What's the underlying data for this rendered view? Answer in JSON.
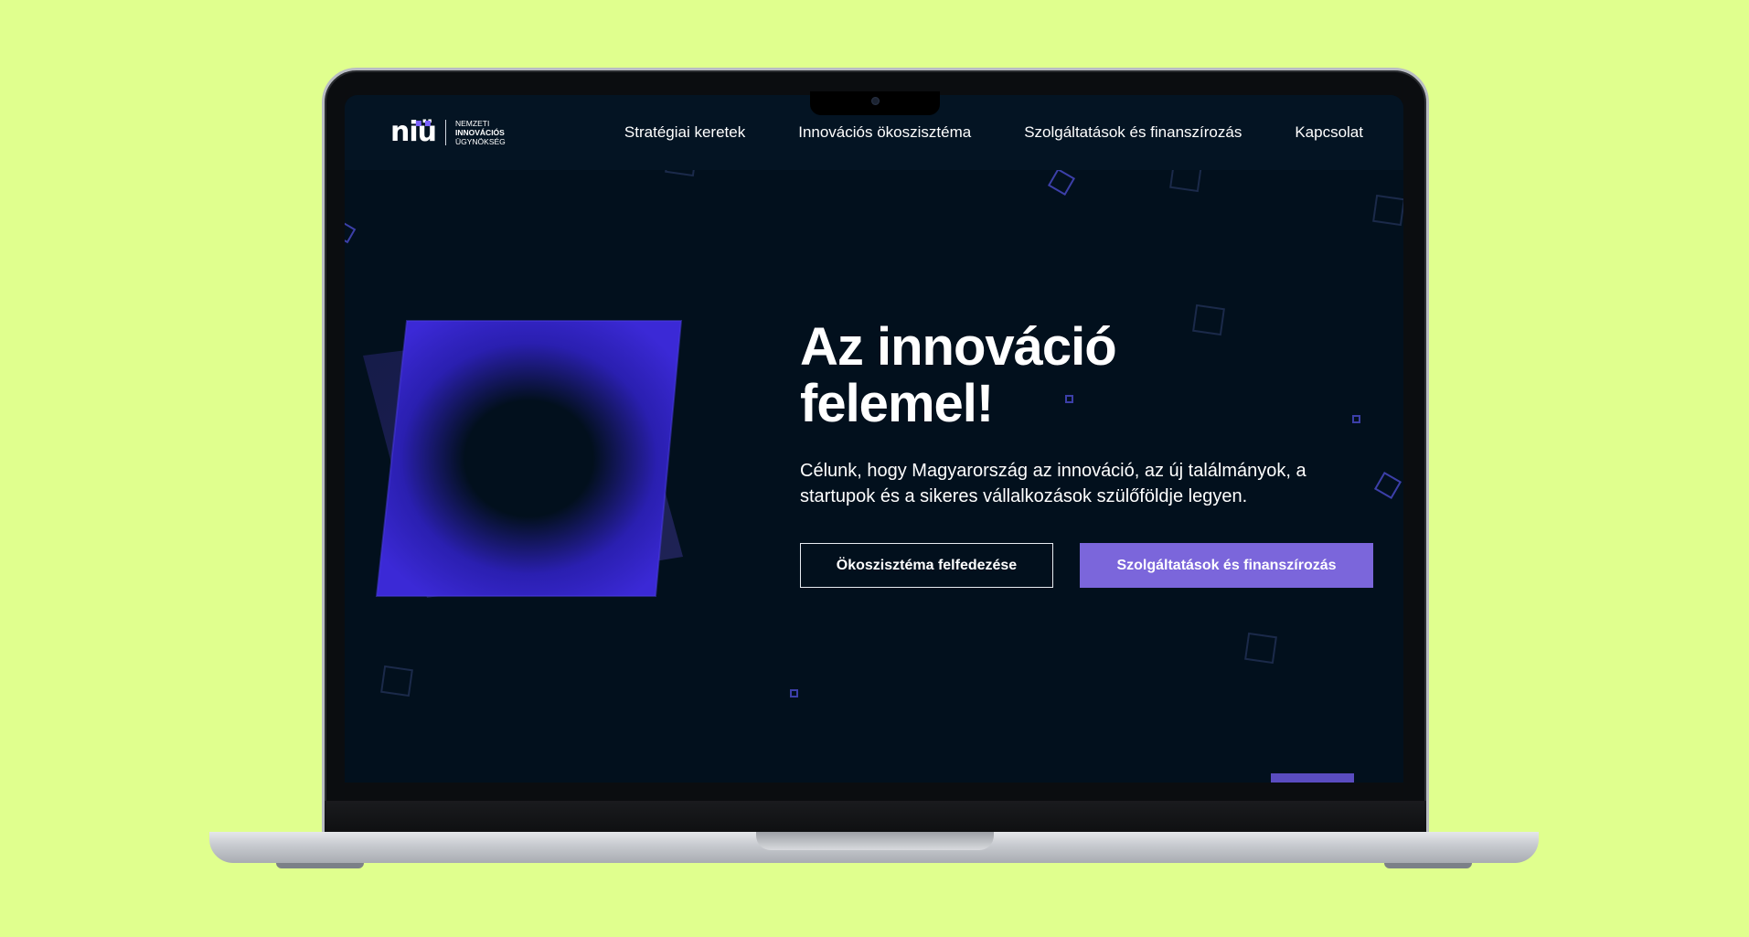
{
  "nav": {
    "logo": {
      "mark": "niü",
      "line1": "NEMZETI",
      "line2": "INNOVÁCIÓS",
      "line3": "ÜGYNÖKSÉG"
    },
    "links": [
      {
        "label": "Stratégiai keretek"
      },
      {
        "label": "Innovációs ökoszisztéma"
      },
      {
        "label": "Szolgáltatások és finanszírozás"
      },
      {
        "label": "Kapcsolat"
      }
    ]
  },
  "hero": {
    "title_line1": "Az innováció",
    "title_line2": "felemel!",
    "subtitle": "Célunk, hogy Magyarország az innováció, az új találmányok, a startupok és a sikeres vállalkozások szülőföldje legyen.",
    "button_secondary": "Ökoszisztéma felfedezése",
    "button_primary": "Szolgáltatások és finanszírozás"
  },
  "colors": {
    "background": "#e0ff8e",
    "screen": "#02101d",
    "accent": "#7b66db",
    "graphic": "#3a26c9"
  }
}
